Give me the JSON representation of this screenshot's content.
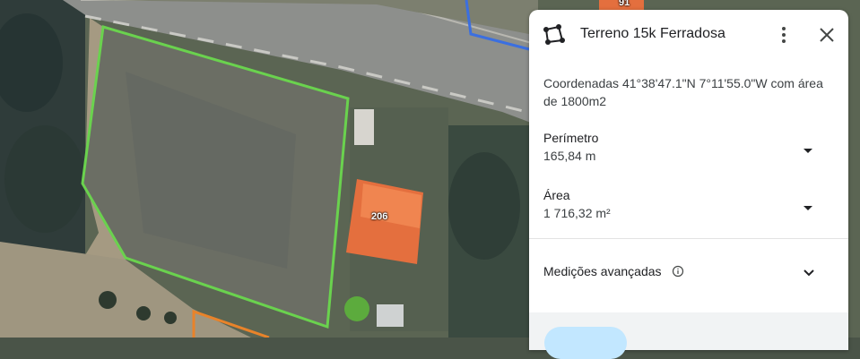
{
  "map": {
    "parcel_labels": [
      "206",
      "91"
    ],
    "boundary_color": "#6ad24e",
    "neighbor_parcel_color": "#3b6fe0",
    "neighbor_parcel_color_2": "#e8832a"
  },
  "panel": {
    "icon": "polygon-shape-icon",
    "title": "Terreno 15k Ferradosa",
    "more_icon": "more-vert-icon",
    "close_icon": "close-icon",
    "coordinates": "Coordenadas 41°38'47.1\"N 7°11'55.0\"W com área de 1800m2",
    "perimeter": {
      "label": "Perímetro",
      "value": "165,84 m"
    },
    "area": {
      "label": "Área",
      "value": "1 716,32 m²"
    },
    "advanced": {
      "label": "Medições avançadas"
    }
  }
}
